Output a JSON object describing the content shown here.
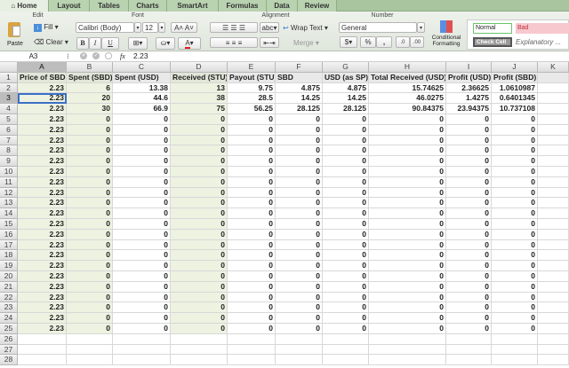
{
  "tabs": [
    "Home",
    "Layout",
    "Tables",
    "Charts",
    "SmartArt",
    "Formulas",
    "Data",
    "Review"
  ],
  "ribbon": {
    "groups": {
      "edit": "Edit",
      "font": "Font",
      "alignment": "Alignment",
      "number": "Number"
    },
    "paste": "Paste",
    "fill": "Fill",
    "clear": "Clear",
    "font_name": "Calibri (Body)",
    "font_size": "12",
    "bold": "B",
    "italic": "I",
    "underline": "U",
    "wrap_text": "Wrap Text",
    "merge": "Merge",
    "wrap_label": "abc",
    "number_format": "General",
    "percent": "%",
    "comma": ",",
    "conditional_formatting": "Conditional Formatting",
    "styles": {
      "normal": "Normal",
      "bad": "Bad",
      "check_cell": "Check Cell",
      "explanatory": "Explanatory ..."
    }
  },
  "formula_bar": {
    "name_box": "A3",
    "fx": "fx",
    "value": "2.23"
  },
  "columns": [
    "A",
    "B",
    "C",
    "D",
    "E",
    "F",
    "G",
    "H",
    "I",
    "J",
    "K"
  ],
  "headers": [
    "Price of SBD",
    "Spent (SBD)",
    "Spent (USD)",
    "Received (STU)",
    "Payout (STU)",
    "SBD",
    "USD (as SP)",
    "Total Received (USD)",
    "Profit (USD)",
    "Profit (SBD)",
    ""
  ],
  "rows": [
    [
      "2.23",
      "6",
      "13.38",
      "13",
      "9.75",
      "4.875",
      "4.875",
      "15.74625",
      "2.36625",
      "1.0610987",
      ""
    ],
    [
      "2.23",
      "20",
      "44.6",
      "38",
      "28.5",
      "14.25",
      "14.25",
      "46.0275",
      "1.4275",
      "0.6401345",
      ""
    ],
    [
      "2.23",
      "30",
      "66.9",
      "75",
      "56.25",
      "28.125",
      "28.125",
      "90.84375",
      "23.94375",
      "10.737108",
      ""
    ],
    [
      "2.23",
      "0",
      "0",
      "0",
      "0",
      "0",
      "0",
      "0",
      "0",
      "0",
      ""
    ],
    [
      "2.23",
      "0",
      "0",
      "0",
      "0",
      "0",
      "0",
      "0",
      "0",
      "0",
      ""
    ],
    [
      "2.23",
      "0",
      "0",
      "0",
      "0",
      "0",
      "0",
      "0",
      "0",
      "0",
      ""
    ],
    [
      "2.23",
      "0",
      "0",
      "0",
      "0",
      "0",
      "0",
      "0",
      "0",
      "0",
      ""
    ],
    [
      "2.23",
      "0",
      "0",
      "0",
      "0",
      "0",
      "0",
      "0",
      "0",
      "0",
      ""
    ],
    [
      "2.23",
      "0",
      "0",
      "0",
      "0",
      "0",
      "0",
      "0",
      "0",
      "0",
      ""
    ],
    [
      "2.23",
      "0",
      "0",
      "0",
      "0",
      "0",
      "0",
      "0",
      "0",
      "0",
      ""
    ],
    [
      "2.23",
      "0",
      "0",
      "0",
      "0",
      "0",
      "0",
      "0",
      "0",
      "0",
      ""
    ],
    [
      "2.23",
      "0",
      "0",
      "0",
      "0",
      "0",
      "0",
      "0",
      "0",
      "0",
      ""
    ],
    [
      "2.23",
      "0",
      "0",
      "0",
      "0",
      "0",
      "0",
      "0",
      "0",
      "0",
      ""
    ],
    [
      "2.23",
      "0",
      "0",
      "0",
      "0",
      "0",
      "0",
      "0",
      "0",
      "0",
      ""
    ],
    [
      "2.23",
      "0",
      "0",
      "0",
      "0",
      "0",
      "0",
      "0",
      "0",
      "0",
      ""
    ],
    [
      "2.23",
      "0",
      "0",
      "0",
      "0",
      "0",
      "0",
      "0",
      "0",
      "0",
      ""
    ],
    [
      "2.23",
      "0",
      "0",
      "0",
      "0",
      "0",
      "0",
      "0",
      "0",
      "0",
      ""
    ],
    [
      "2.23",
      "0",
      "0",
      "0",
      "0",
      "0",
      "0",
      "0",
      "0",
      "0",
      ""
    ],
    [
      "2.23",
      "0",
      "0",
      "0",
      "0",
      "0",
      "0",
      "0",
      "0",
      "0",
      ""
    ],
    [
      "2.23",
      "0",
      "0",
      "0",
      "0",
      "0",
      "0",
      "0",
      "0",
      "0",
      ""
    ],
    [
      "2.23",
      "0",
      "0",
      "0",
      "0",
      "0",
      "0",
      "0",
      "0",
      "0",
      ""
    ],
    [
      "2.23",
      "0",
      "0",
      "0",
      "0",
      "0",
      "0",
      "0",
      "0",
      "0",
      ""
    ],
    [
      "2.23",
      "0",
      "0",
      "0",
      "0",
      "0",
      "0",
      "0",
      "0",
      "0",
      ""
    ],
    [
      "2.23",
      "0",
      "0",
      "0",
      "0",
      "0",
      "0",
      "0",
      "0",
      "0",
      ""
    ],
    [
      "",
      "",
      "",
      "",
      "",
      "",
      "",
      "",
      "",
      "",
      ""
    ],
    [
      "",
      "",
      "",
      "",
      "",
      "",
      "",
      "",
      "",
      "",
      ""
    ],
    [
      "",
      "",
      "",
      "",
      "",
      "",
      "",
      "",
      "",
      "",
      ""
    ]
  ],
  "row_numbers": [
    "1",
    "2",
    "3",
    "4",
    "5",
    "6",
    "7",
    "8",
    "9",
    "10",
    "11",
    "12",
    "13",
    "14",
    "15",
    "16",
    "17",
    "18",
    "19",
    "20",
    "21",
    "22",
    "23",
    "24",
    "25",
    "26",
    "27",
    "28"
  ],
  "selected_cell": "A3"
}
